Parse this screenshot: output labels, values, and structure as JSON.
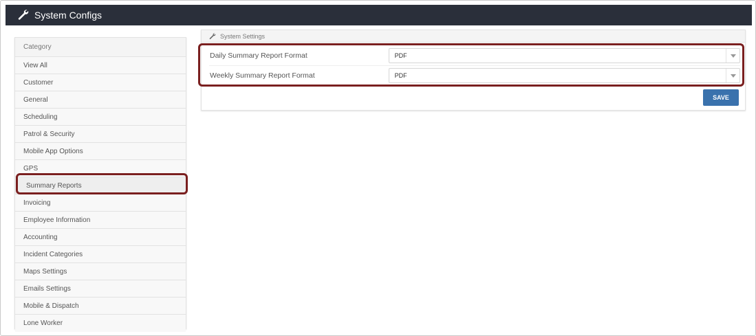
{
  "header": {
    "title": "System Configs",
    "icon": "wrench-icon"
  },
  "sidebar": {
    "header": "Category",
    "items": [
      {
        "label": "View All"
      },
      {
        "label": "Customer"
      },
      {
        "label": "General"
      },
      {
        "label": "Scheduling"
      },
      {
        "label": "Patrol & Security"
      },
      {
        "label": "Mobile App Options"
      },
      {
        "label": "GPS"
      },
      {
        "label": "Summary Reports",
        "active": true
      },
      {
        "label": "Invoicing"
      },
      {
        "label": "Employee Information"
      },
      {
        "label": "Accounting"
      },
      {
        "label": "Incident Categories"
      },
      {
        "label": "Maps Settings"
      },
      {
        "label": "Emails Settings"
      },
      {
        "label": "Mobile & Dispatch"
      },
      {
        "label": "Lone Worker"
      }
    ]
  },
  "panel": {
    "title": "System Settings",
    "icon": "wrench-icon",
    "fields": [
      {
        "label": "Daily Summary Report Format",
        "value": "PDF"
      },
      {
        "label": "Weekly Summary Report Format",
        "value": "PDF"
      }
    ],
    "save_label": "SAVE"
  },
  "colors": {
    "topbar": "#2a2f3a",
    "highlight": "#7a1f1f",
    "save_button": "#3a72ad"
  }
}
